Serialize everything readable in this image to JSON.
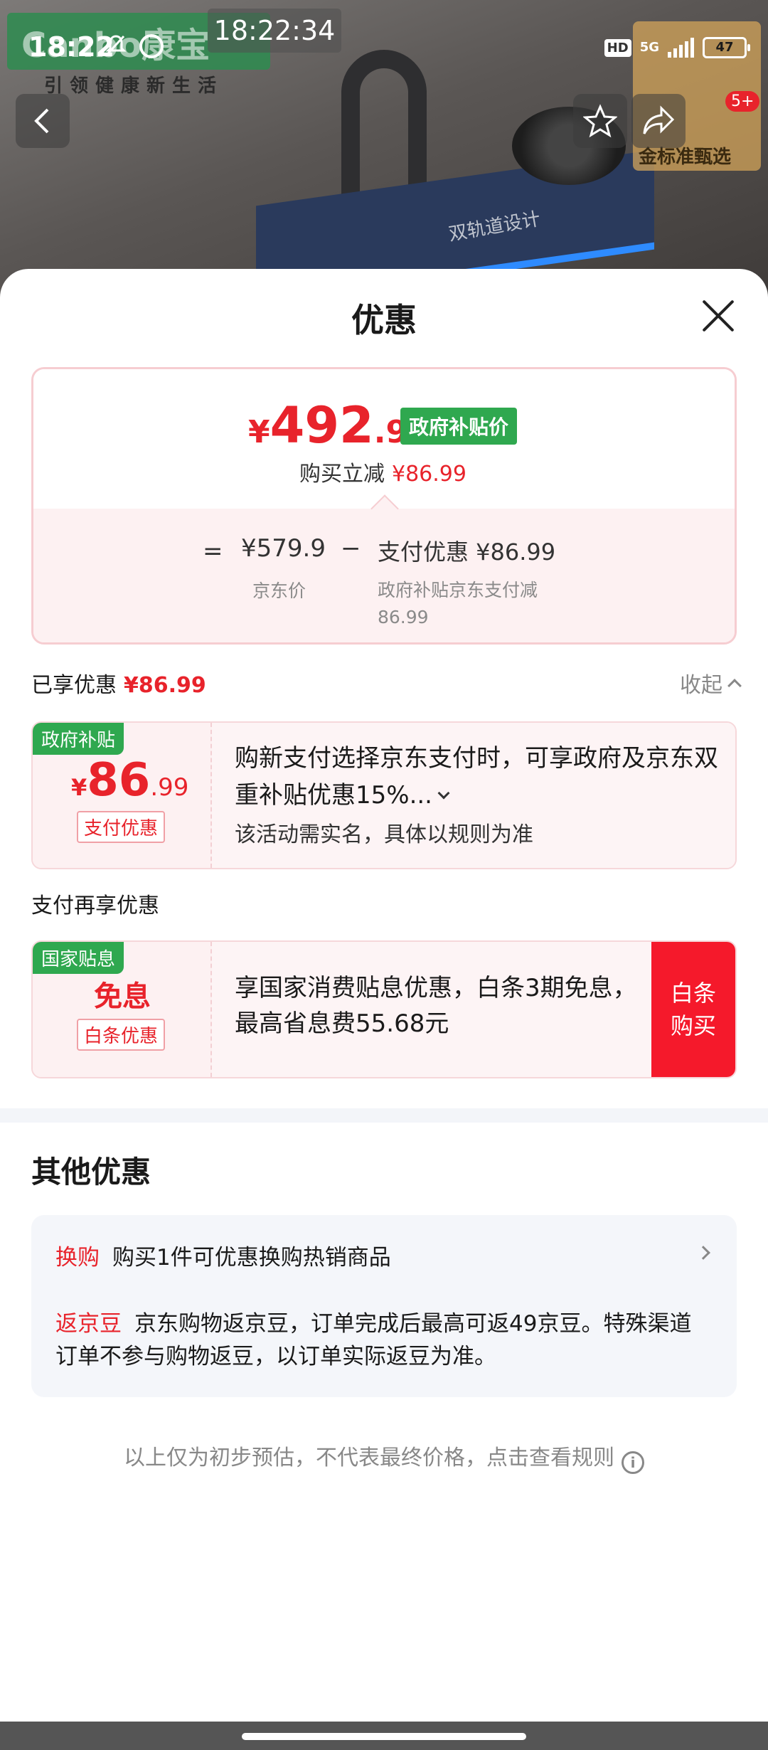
{
  "status_bar": {
    "time": "18:22",
    "overlay_time": "18:22:34",
    "hd_label": "HD",
    "network_label": "5G",
    "battery_level": "47"
  },
  "background": {
    "brand_text": "Canbo康宝",
    "slogan": "引领健康新生活",
    "sink_label": "双轨道设计",
    "gold_badge_text": "金标准甄选"
  },
  "nav": {
    "back_icon": "chevron-left-icon",
    "star_icon": "star-icon",
    "share_icon": "share-icon",
    "badge_count": "5+"
  },
  "sheet": {
    "title": "优惠",
    "close_icon": "close-icon"
  },
  "price_card": {
    "currency": "¥",
    "price_int": "492",
    "price_dec": ".91",
    "gov_tag": "政府补贴价",
    "buy_off_label": "购买立减",
    "buy_off_value": "¥86.99",
    "equals": "=",
    "jd_price": "¥579.9",
    "minus": "−",
    "pay_off": "支付优惠 ¥86.99",
    "jd_price_label": "京东价",
    "pay_off_label": "政府补贴京东支付减86.99"
  },
  "enjoyed": {
    "label": "已享优惠",
    "value": "¥86.99",
    "collapse_label": "收起"
  },
  "coupon_subsidy": {
    "corner_tag": "政府补贴",
    "currency": "¥",
    "amount_int": "86",
    "amount_dec": ".99",
    "sub_tag": "支付优惠",
    "description": "购新支付选择京东支付时，可享政府及京东双重补贴优惠15%...",
    "note": "该活动需实名，具体以规则为准"
  },
  "pay_again_label": "支付再享优惠",
  "coupon_interest": {
    "corner_tag": "国家贴息",
    "title": "免息",
    "sub_tag": "白条优惠",
    "description": "享国家消费贴息优惠，白条3期免息，最高省息费55.68元",
    "buy_button": "白条购买"
  },
  "other_offers": {
    "title": "其他优惠",
    "items": [
      {
        "tag": "换购",
        "text": "购买1件可优惠换购热销商品"
      },
      {
        "tag": "返京豆",
        "text": "京东购物返京豆，订单完成后最高可返49京豆。特殊渠道订单不参与购物返豆，以订单实际返豆为准。"
      }
    ]
  },
  "footer_note": "以上仅为初步预估，不代表最终价格，点击查看规则",
  "colors": {
    "accent_red": "#e8232b",
    "gov_green": "#2fa84f",
    "buy_red": "#f5192b"
  }
}
